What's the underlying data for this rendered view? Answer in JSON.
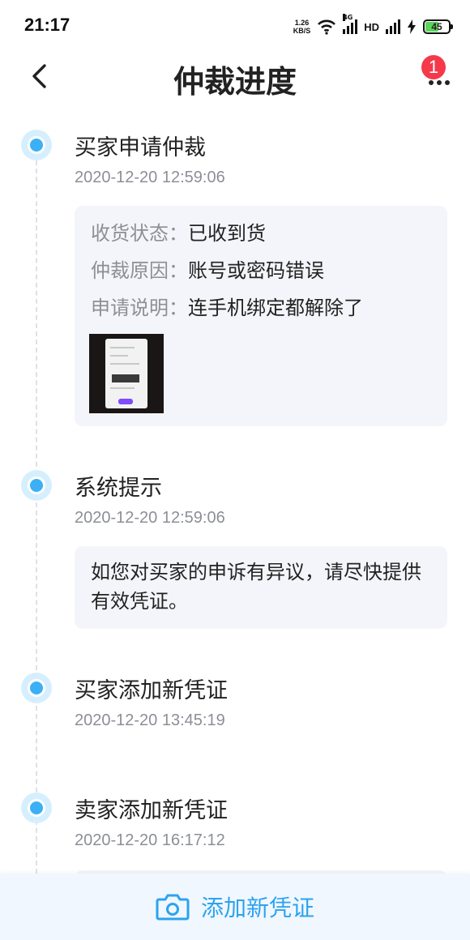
{
  "status_bar": {
    "time": "21:17",
    "net_speed_value": "1.26",
    "net_speed_unit": "KB/S",
    "network_tag": "4G",
    "hd": "HD",
    "battery": "45"
  },
  "header": {
    "title": "仲裁进度",
    "badge_count": "1"
  },
  "timeline": [
    {
      "title": "买家申请仲裁",
      "time": "2020-12-20 12:59:06",
      "details": [
        {
          "key": "收货状态：",
          "value": "已收到货"
        },
        {
          "key": "仲裁原因：",
          "value": "账号或密码错误"
        },
        {
          "key": "申请说明：",
          "value": "连手机绑定都解除了"
        }
      ]
    },
    {
      "title": "系统提示",
      "time": "2020-12-20 12:59:06",
      "notice": "如您对买家的申诉有异议，请尽快提供有效凭证。"
    },
    {
      "title": "买家添加新凭证",
      "time": "2020-12-20 13:45:19"
    },
    {
      "title": "卖家添加新凭证",
      "time": "2020-12-20 16:17:12"
    }
  ],
  "bottom": {
    "add_label": "添加新凭证"
  },
  "colors": {
    "accent": "#2ba3ef",
    "dot": "#3bb0f5",
    "badge": "#f5394a",
    "card_bg": "#f4f5fa"
  }
}
